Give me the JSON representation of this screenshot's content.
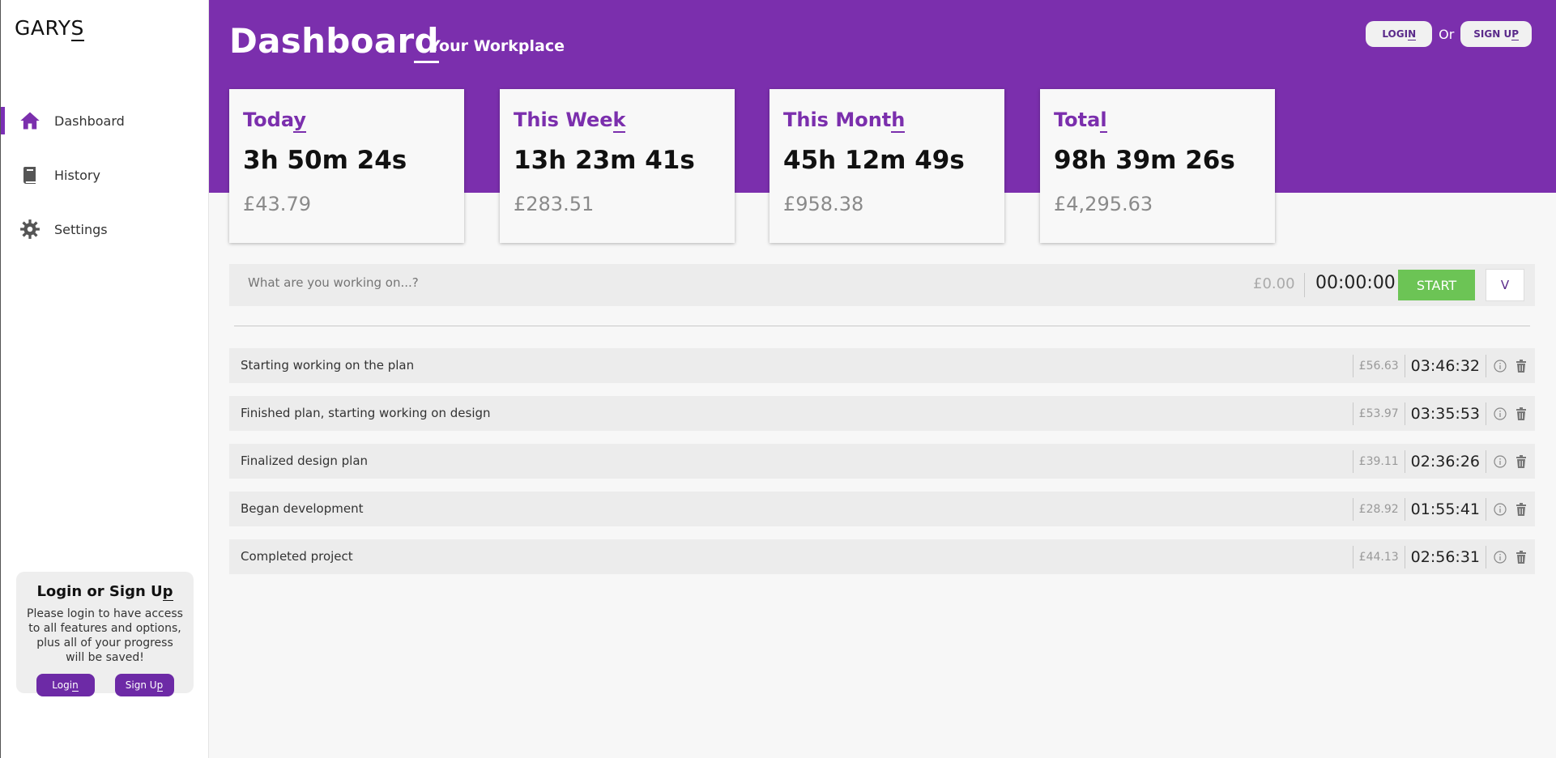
{
  "brand": {
    "prefix": "GARY",
    "underlined": "S"
  },
  "nav": [
    {
      "label": "Dashboard",
      "icon": "home-icon"
    },
    {
      "label": "History",
      "icon": "book-icon"
    },
    {
      "label": "Settings",
      "icon": "gear-icon"
    }
  ],
  "login_card": {
    "title_prefix": "Login or Sign U",
    "title_underlined": "p",
    "description": "Please login to have access to all features and options, plus all of your progress will be saved!",
    "login_prefix": "Logi",
    "login_underlined": "n",
    "signup_prefix": "Sign U",
    "signup_underlined": "p"
  },
  "header": {
    "title_prefix": "Dashboar",
    "title_underlined": "d",
    "subtitle": "Your Workplace",
    "login_prefix": "LOGI",
    "login_underlined": "N",
    "or": "Or",
    "signup_prefix": "SIGN U",
    "signup_underlined": "P"
  },
  "stats": [
    {
      "label_prefix": "Toda",
      "label_underlined": "y",
      "time": "3h 50m 24s",
      "money": "£43.79"
    },
    {
      "label_prefix": "This Wee",
      "label_underlined": "k",
      "time": "13h 23m 41s",
      "money": "£283.51"
    },
    {
      "label_prefix": "This Mont",
      "label_underlined": "h",
      "time": "45h 12m 49s",
      "money": "£958.38"
    },
    {
      "label_prefix": "Tota",
      "label_underlined": "l",
      "time": "98h 39m 26s",
      "money": "£4,295.63"
    }
  ],
  "timer": {
    "placeholder": "What are you working on...?",
    "money": "£0.00",
    "clock": "00:00:00",
    "start_label": "START",
    "toggle_label": "V"
  },
  "entries": [
    {
      "description": "Starting working on the plan",
      "money": "£56.63",
      "duration": "03:46:32"
    },
    {
      "description": "Finished plan, starting working on design",
      "money": "£53.97",
      "duration": "03:35:53"
    },
    {
      "description": "Finalized design plan",
      "money": "£39.11",
      "duration": "02:36:26"
    },
    {
      "description": "Began development",
      "money": "£28.92",
      "duration": "01:55:41"
    },
    {
      "description": "Completed project",
      "money": "£44.13",
      "duration": "02:56:31"
    }
  ],
  "colors": {
    "brand_purple": "#7b2fad",
    "start_green": "#6cc455",
    "panel_grey": "#ececec"
  }
}
